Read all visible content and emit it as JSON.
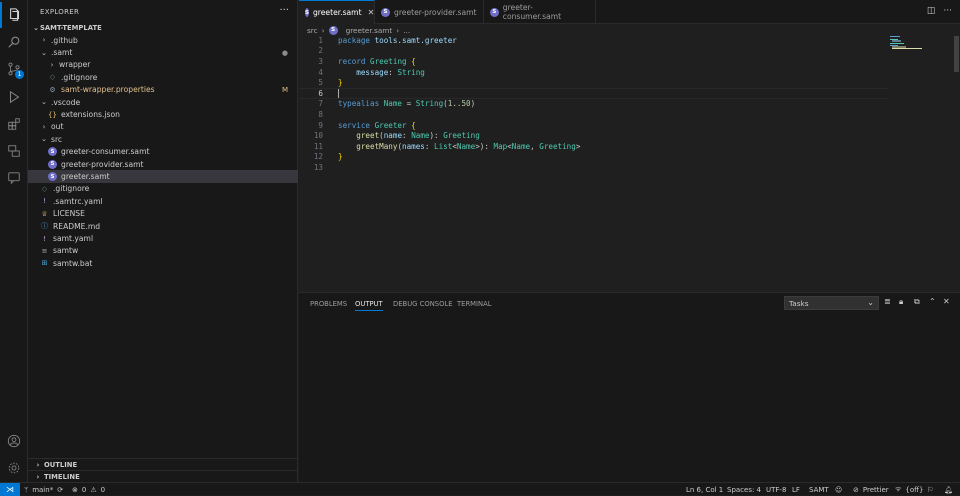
{
  "activity_bar": {
    "items": [
      "explorer-icon",
      "search-icon",
      "source-control-icon",
      "run-debug-icon",
      "extensions-icon",
      "remote-explorer-icon",
      "chat-icon"
    ],
    "source_control_badge": "1",
    "bottom": [
      "account-icon",
      "manage-gear-icon"
    ]
  },
  "sidebar": {
    "title": "EXPLORER",
    "more": "···",
    "root": "SAMT-TEMPLATE",
    "tree": [
      {
        "label": ".github",
        "kind": "folder",
        "open": false,
        "depth": 1
      },
      {
        "label": ".samt",
        "kind": "folder",
        "open": true,
        "depth": 1,
        "deco": "●"
      },
      {
        "label": "wrapper",
        "kind": "folder",
        "open": false,
        "depth": 2
      },
      {
        "label": ".gitignore",
        "kind": "gitignore",
        "depth": 2
      },
      {
        "label": "samt-wrapper.properties",
        "kind": "gear",
        "depth": 2,
        "deco": "M"
      },
      {
        "label": ".vscode",
        "kind": "folder",
        "open": true,
        "depth": 1
      },
      {
        "label": "extensions.json",
        "kind": "json",
        "depth": 2
      },
      {
        "label": "out",
        "kind": "folder",
        "open": false,
        "depth": 1
      },
      {
        "label": "src",
        "kind": "folder",
        "open": true,
        "depth": 1
      },
      {
        "label": "greeter-consumer.samt",
        "kind": "samt",
        "depth": 2
      },
      {
        "label": "greeter-provider.samt",
        "kind": "samt",
        "depth": 2
      },
      {
        "label": "greeter.samt",
        "kind": "samt",
        "depth": 2,
        "selected": true
      },
      {
        "label": ".gitignore",
        "kind": "gitignore",
        "depth": 1
      },
      {
        "label": ".samtrc.yaml",
        "kind": "yaml",
        "depth": 1
      },
      {
        "label": "LICENSE",
        "kind": "license",
        "depth": 1
      },
      {
        "label": "README.md",
        "kind": "info",
        "depth": 1
      },
      {
        "label": "samt.yaml",
        "kind": "yaml",
        "depth": 1
      },
      {
        "label": "samtw",
        "kind": "lines",
        "depth": 1
      },
      {
        "label": "samtw.bat",
        "kind": "windows",
        "depth": 1
      }
    ],
    "outline": "OUTLINE",
    "timeline": "TIMELINE"
  },
  "tabs": [
    {
      "label": "greeter.samt",
      "active": true,
      "close": "✕"
    },
    {
      "label": "greeter-provider.samt",
      "active": false
    },
    {
      "label": "greeter-consumer.samt",
      "active": false
    }
  ],
  "breadcrumb": {
    "folder": "src",
    "file": "greeter.samt",
    "more": "..."
  },
  "editor": {
    "current_line": 6,
    "lines": [
      [
        {
          "t": "package ",
          "c": "kw"
        },
        {
          "t": "tools.samt.greeter",
          "c": "pa"
        }
      ],
      [],
      [
        {
          "t": "record ",
          "c": "kw"
        },
        {
          "t": "Greeting ",
          "c": "ty"
        },
        {
          "t": "{",
          "c": "br"
        }
      ],
      [
        {
          "t": "    message",
          "c": "pa"
        },
        {
          "t": ": "
        },
        {
          "t": "String",
          "c": "ty"
        }
      ],
      [
        {
          "t": "}",
          "c": "br"
        }
      ],
      [],
      [
        {
          "t": "typealias ",
          "c": "kw"
        },
        {
          "t": "Name",
          "c": "ty"
        },
        {
          "t": " = "
        },
        {
          "t": "String",
          "c": "ty"
        },
        {
          "t": "("
        },
        {
          "t": "1",
          "c": "nu"
        },
        {
          "t": ".."
        },
        {
          "t": "50",
          "c": "nu"
        },
        {
          "t": ")"
        }
      ],
      [],
      [
        {
          "t": "service ",
          "c": "kw"
        },
        {
          "t": "Greeter ",
          "c": "ty"
        },
        {
          "t": "{",
          "c": "br"
        }
      ],
      [
        {
          "t": "    greet",
          "c": "fn"
        },
        {
          "t": "("
        },
        {
          "t": "name",
          "c": "pa"
        },
        {
          "t": ": "
        },
        {
          "t": "Name",
          "c": "ty"
        },
        {
          "t": "): "
        },
        {
          "t": "Greeting",
          "c": "ty"
        }
      ],
      [
        {
          "t": "    greetMany",
          "c": "fn"
        },
        {
          "t": "("
        },
        {
          "t": "names",
          "c": "pa"
        },
        {
          "t": ": "
        },
        {
          "t": "List",
          "c": "ty"
        },
        {
          "t": "<"
        },
        {
          "t": "Name",
          "c": "ty"
        },
        {
          "t": ">): "
        },
        {
          "t": "Map",
          "c": "ty"
        },
        {
          "t": "<"
        },
        {
          "t": "Name",
          "c": "ty"
        },
        {
          "t": ", "
        },
        {
          "t": "Greeting",
          "c": "ty"
        },
        {
          "t": ">"
        }
      ],
      [
        {
          "t": "}",
          "c": "br"
        }
      ],
      []
    ]
  },
  "panel": {
    "tabs": [
      {
        "label": "PROBLEMS",
        "active": false
      },
      {
        "label": "OUTPUT",
        "active": true
      },
      {
        "label": "DEBUG CONSOLE",
        "active": false
      },
      {
        "label": "TERMINAL",
        "active": false
      }
    ],
    "output_channel": "Tasks"
  },
  "status": {
    "branch": "main*",
    "errors": "0",
    "warnings": "0",
    "position": "Ln 6, Col 1",
    "spaces": "Spaces: 4",
    "encoding": "UTF-8",
    "eol": "LF",
    "language": "SAMT",
    "prettier": "Prettier",
    "copilot": "{off}"
  },
  "colors": {
    "accent": "#0078d4",
    "modified": "#e2c08d",
    "samt_icon": "#6e6ec8"
  }
}
